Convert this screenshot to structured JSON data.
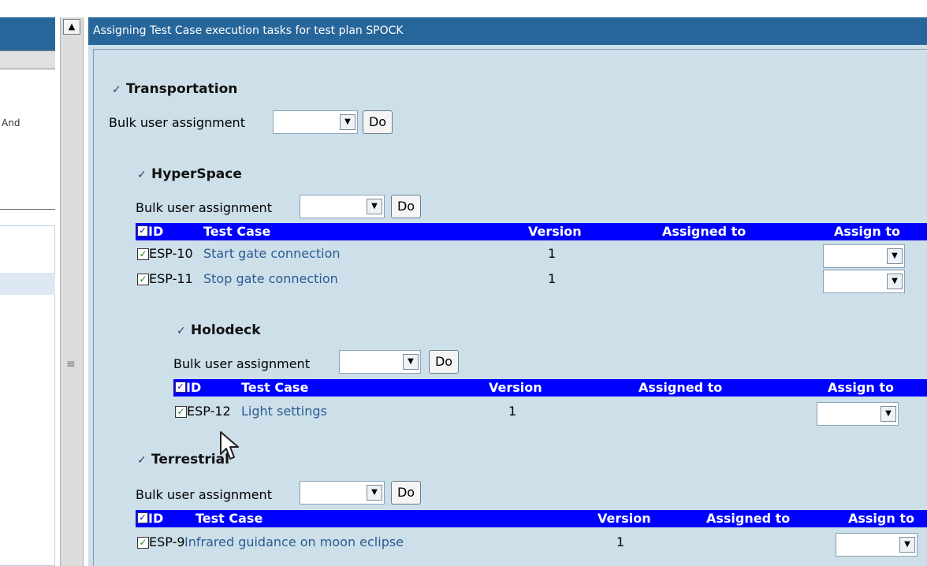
{
  "header": {
    "title": "Assigning Test Case execution tasks for test plan SPOCK"
  },
  "left_panel": {
    "partial_text": "And"
  },
  "splitter": {
    "collapse_glyph": "▲",
    "grip_glyph": "≡"
  },
  "bulk": {
    "label": "Bulk user assignment",
    "do_label": "Do",
    "select_value": ""
  },
  "table_headers": {
    "id": "ID",
    "test_case": "Test Case",
    "version": "Version",
    "assigned_to": "Assigned to",
    "assign_to": "Assign to"
  },
  "nodes": {
    "transportation": {
      "title": "Transportation"
    },
    "hyperspace": {
      "title": "HyperSpace",
      "rows": [
        {
          "id": "ESP-10",
          "name": "Start gate connection",
          "version": "1",
          "assigned_to": "",
          "assign_to": ""
        },
        {
          "id": "ESP-11",
          "name": "Stop gate connection",
          "version": "1",
          "assigned_to": "",
          "assign_to": ""
        }
      ]
    },
    "holodeck": {
      "title": "Holodeck",
      "rows": [
        {
          "id": "ESP-12",
          "name": "Light settings",
          "version": "1",
          "assigned_to": "",
          "assign_to": ""
        }
      ]
    },
    "terrestrial": {
      "title": "Terrestrial",
      "rows": [
        {
          "id": "ESP-9",
          "name": "Infrared guidance on moon eclipse",
          "version": "1",
          "assigned_to": "",
          "assign_to": ""
        }
      ]
    }
  },
  "icons": {
    "node": "tree-node-icon",
    "checkbox": "checkbox-checked-icon",
    "dropdown": "chevron-down-icon",
    "cursor": "mouse-pointer-icon"
  },
  "colors": {
    "header_bg": "#27669b",
    "table_header_bg": "#0000ff",
    "content_bg": "#cddfe9",
    "link": "#2b5b93"
  }
}
